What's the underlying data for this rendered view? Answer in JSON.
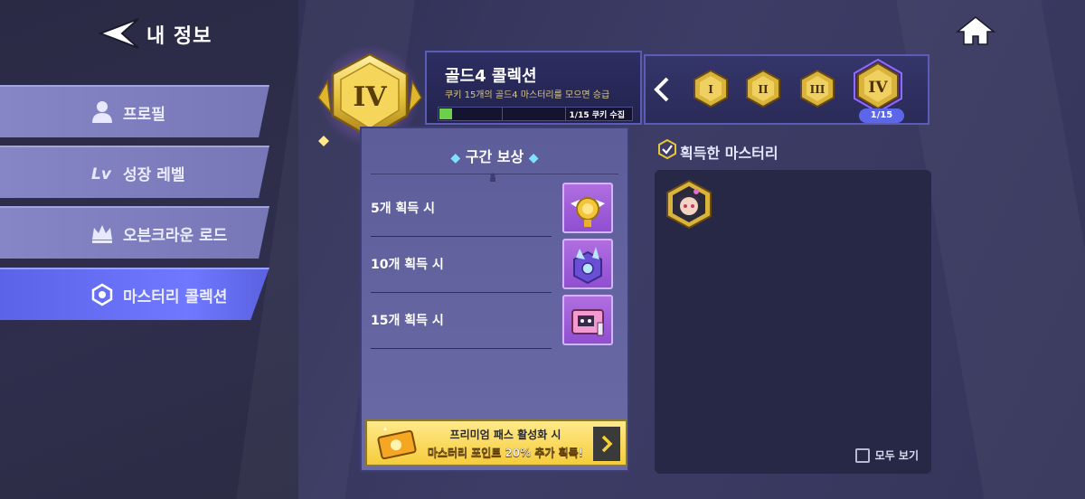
{
  "header": {
    "title": "내 정보"
  },
  "sidebar": {
    "items": [
      {
        "label": "프로필",
        "icon": "person-icon"
      },
      {
        "label": "성장 레벨",
        "icon": "lv-icon"
      },
      {
        "label": "오븐크라운 로드",
        "icon": "crown-icon"
      },
      {
        "label": "마스터리 콜렉션",
        "icon": "mastery-icon",
        "active": true
      }
    ]
  },
  "collection": {
    "tier_numeral": "IV",
    "title": "골드4 콜렉션",
    "description": "쿠키 15개의 골드4 마스터리를 모으면 승급",
    "progress_text": "1/15 쿠키 수집",
    "progress_fraction": 0.0667
  },
  "tiers": {
    "badges": [
      "I",
      "II",
      "III",
      "IV"
    ],
    "active_count": "1/15"
  },
  "rewards": {
    "title": "구간 보상",
    "rows": [
      {
        "label": "5개 획득 시"
      },
      {
        "label": "10개 획득 시"
      },
      {
        "label": "15개 획득 시"
      }
    ]
  },
  "premium": {
    "line1": "프리미엄 패스 활성화 시",
    "line2": "마스터리 포인트 20% 추가 획득!"
  },
  "acquired": {
    "title": "획득한 마스터리",
    "view_all": "모두 보기"
  },
  "colors": {
    "accent": "#5b63e8",
    "gold": "#e8c43a",
    "progress": "#6dd04a"
  }
}
